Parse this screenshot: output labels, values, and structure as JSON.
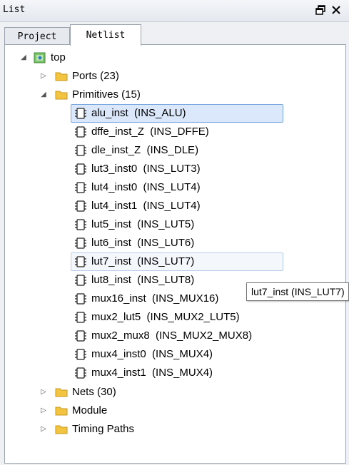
{
  "window": {
    "title": "List",
    "restore_glyph": "🗗",
    "close_glyph": "✕"
  },
  "tabs": [
    {
      "label": "Project",
      "active": false
    },
    {
      "label": "Netlist",
      "active": true
    }
  ],
  "tree": {
    "root": {
      "label": "top",
      "icon": "module-icon"
    },
    "ports": {
      "label": "Ports (23)"
    },
    "primitives": {
      "label": "Primitives (15)",
      "items": [
        {
          "label": "alu_inst  (INS_ALU)"
        },
        {
          "label": "dffe_inst_Z  (INS_DFFE)"
        },
        {
          "label": "dle_inst_Z  (INS_DLE)"
        },
        {
          "label": "lut3_inst0  (INS_LUT3)"
        },
        {
          "label": "lut4_inst0  (INS_LUT4)"
        },
        {
          "label": "lut4_inst1  (INS_LUT4)"
        },
        {
          "label": "lut5_inst  (INS_LUT5)"
        },
        {
          "label": "lut6_inst  (INS_LUT6)"
        },
        {
          "label": "lut7_inst  (INS_LUT7)"
        },
        {
          "label": "lut8_inst  (INS_LUT8)"
        },
        {
          "label": "mux16_inst  (INS_MUX16)"
        },
        {
          "label": "mux2_lut5  (INS_MUX2_LUT5)"
        },
        {
          "label": "mux2_mux8  (INS_MUX2_MUX8)"
        },
        {
          "label": "mux4_inst0  (INS_MUX4)"
        },
        {
          "label": "mux4_inst1  (INS_MUX4)"
        }
      ]
    },
    "nets": {
      "label": "Nets (30)"
    },
    "module": {
      "label": "Module"
    },
    "timing": {
      "label": "Timing Paths"
    }
  },
  "tooltip": {
    "text": "lut7_inst  (INS_LUT7)"
  },
  "colors": {
    "selection_bg": "#dbe8fb",
    "selection_border": "#7aa7de",
    "folder": "#f2c440"
  }
}
